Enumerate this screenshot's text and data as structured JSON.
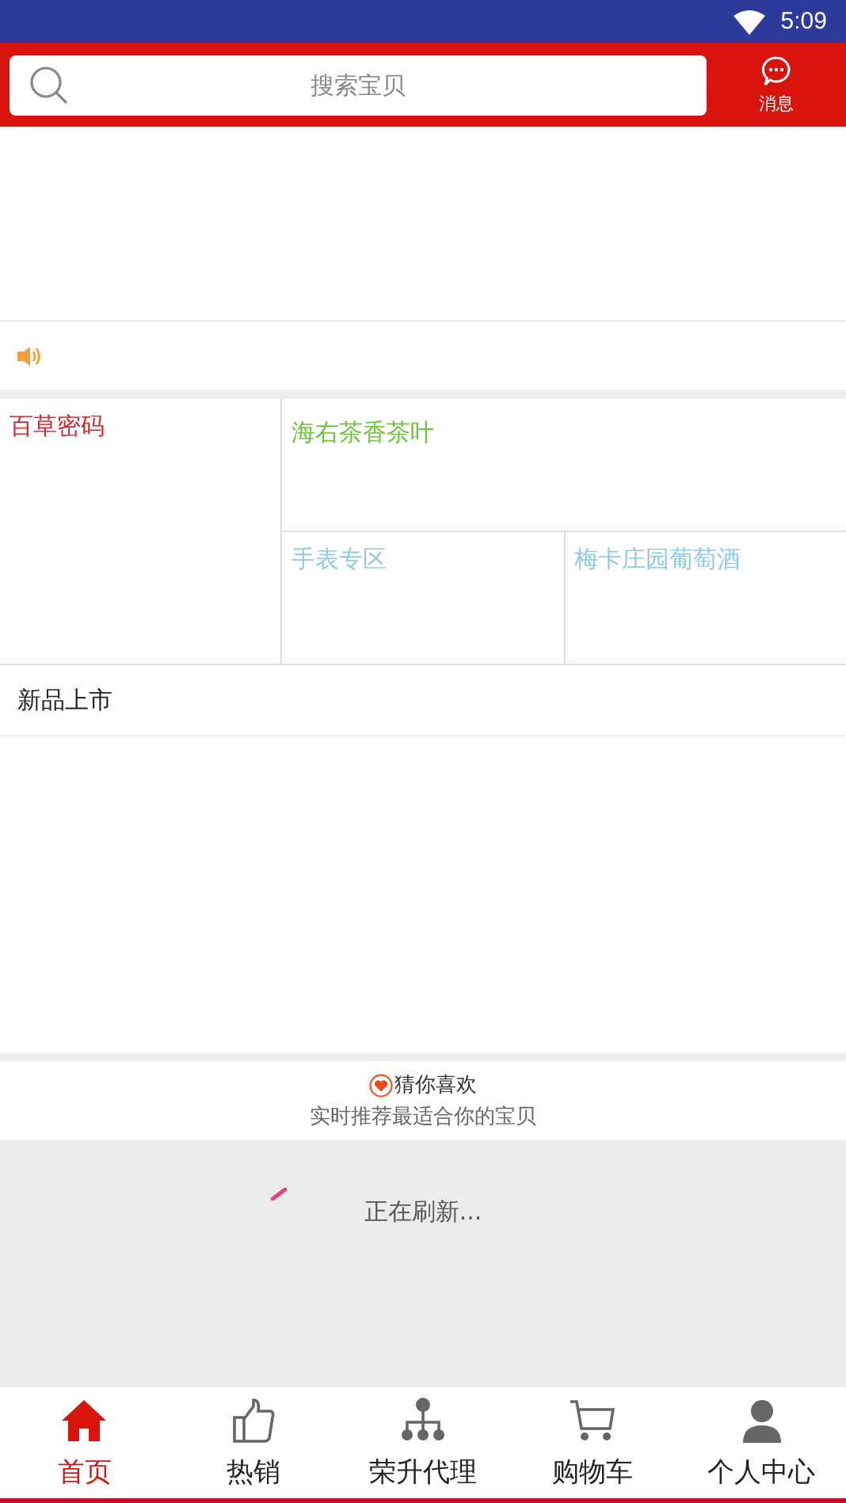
{
  "status_bar": {
    "time": "5:09"
  },
  "header": {
    "search": {
      "placeholder": "搜索宝贝"
    },
    "messages": {
      "label": "消息"
    }
  },
  "categories": [
    {
      "label": "百草密码",
      "color": "#d9262c"
    },
    {
      "label": "海右茶香茶叶",
      "color": "#6cc43a"
    },
    {
      "label": "手表专区",
      "color": "#8dcbe6"
    },
    {
      "label": "梅卡庄园葡萄酒",
      "color": "#8dcbe6"
    }
  ],
  "new_arrivals": {
    "title": "新品上市"
  },
  "recommend": {
    "title": "猜你喜欢",
    "subtitle": "实时推荐最适合你的宝贝"
  },
  "loading": {
    "text": "正在刷新..."
  },
  "nav": [
    {
      "label": "首页",
      "kind": "home",
      "selected": true
    },
    {
      "label": "热销",
      "kind": "thumb",
      "selected": false
    },
    {
      "label": "荣升代理",
      "kind": "tree",
      "selected": false
    },
    {
      "label": "购物车",
      "kind": "cart",
      "selected": false
    },
    {
      "label": "个人中心",
      "kind": "person",
      "selected": false
    }
  ]
}
